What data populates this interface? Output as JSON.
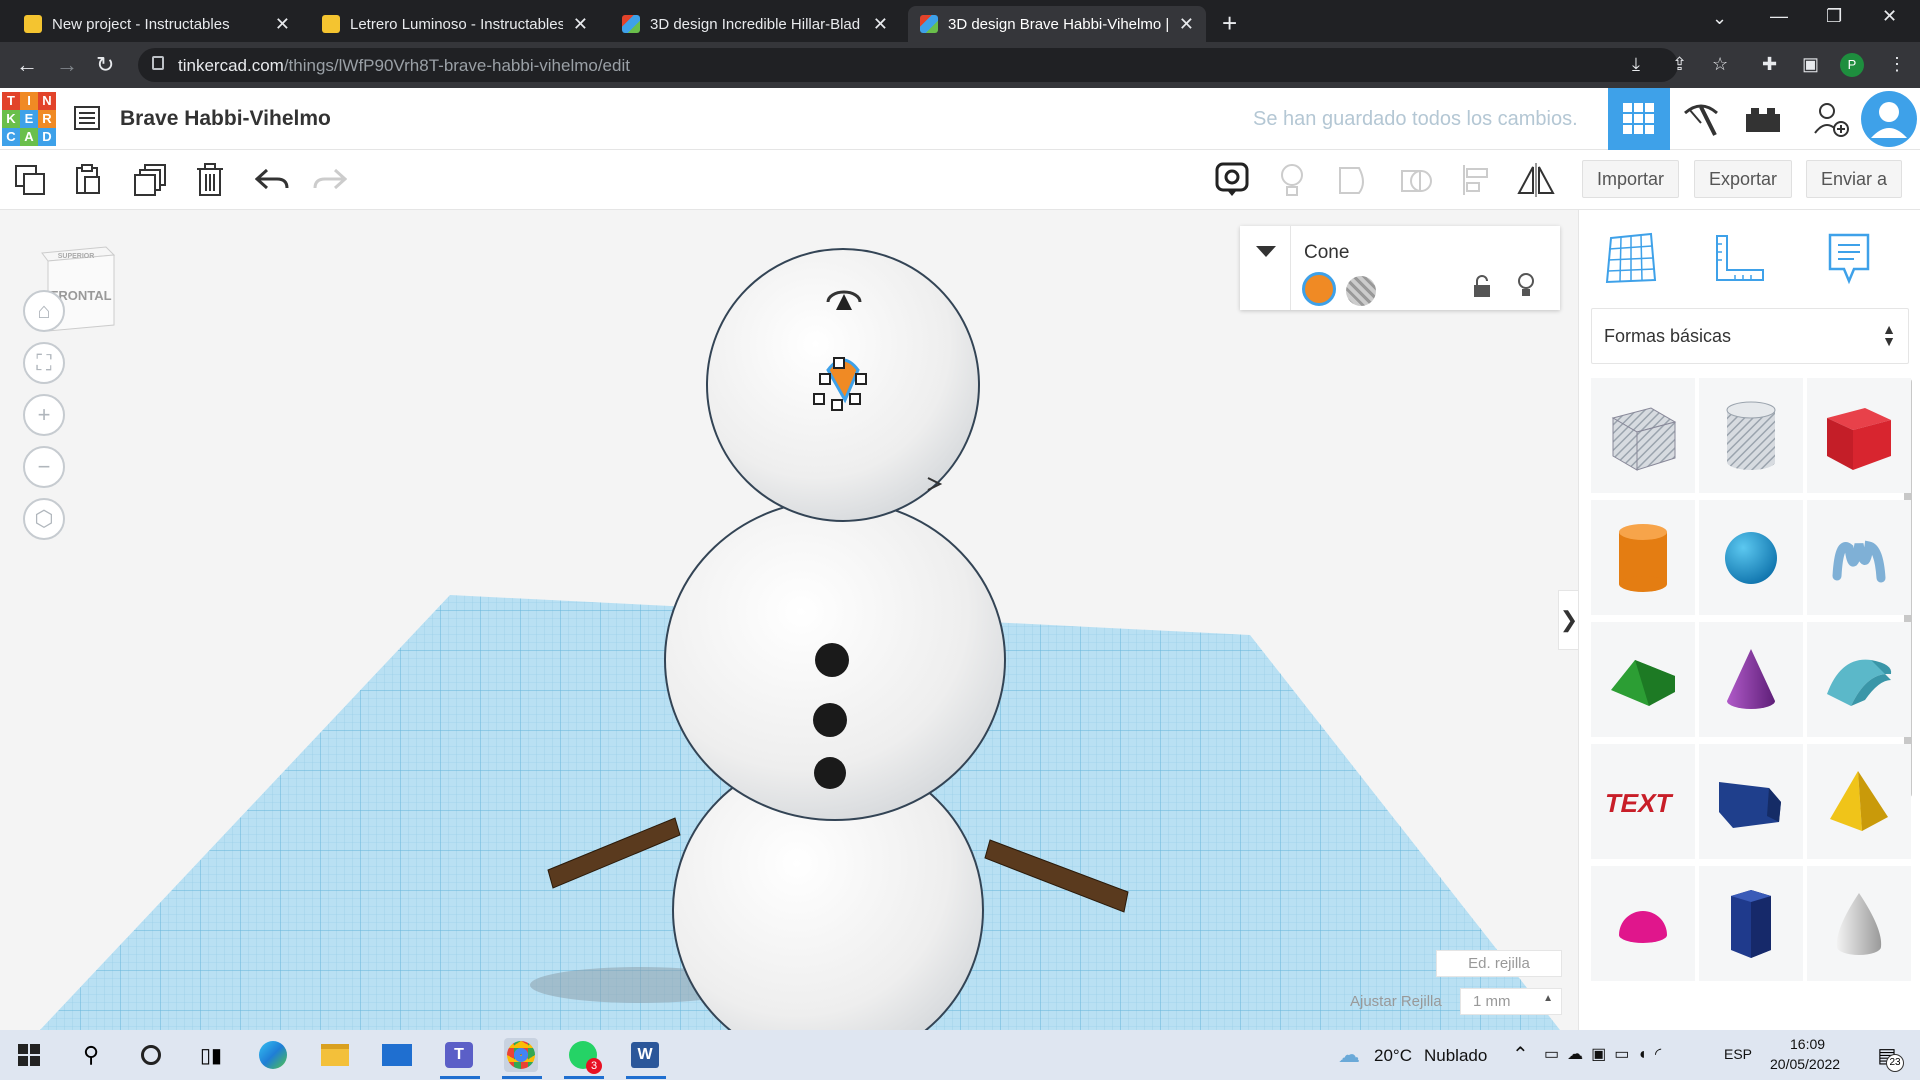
{
  "browser": {
    "tabs": [
      {
        "title": "New project - Instructables",
        "active": false,
        "favicon": "instructables-icon"
      },
      {
        "title": "Letrero Luminoso - Instructables",
        "active": false,
        "favicon": "instructables-icon"
      },
      {
        "title": "3D design Incredible Hillar-Blad |",
        "active": false,
        "favicon": "tinkercad-icon"
      },
      {
        "title": "3D design Brave Habbi-Vihelmo |",
        "active": true,
        "favicon": "tinkercad-icon"
      }
    ],
    "url_host": "tinkercad.com",
    "url_path": "/things/lWfP90Vrh8T-brave-habbi-vihelmo/edit",
    "profile_initial": "P"
  },
  "tinkercad": {
    "logo_letters": [
      "T",
      "I",
      "N",
      "K",
      "E",
      "R",
      "C",
      "A",
      "D"
    ],
    "design_title": "Brave Habbi-Vihelmo",
    "save_status": "Se han guardado todos los cambios.",
    "toolbar": {
      "import_label": "Importar",
      "export_label": "Exportar",
      "send_label": "Enviar a"
    },
    "viewcube": {
      "top_label": "SUPERIOR",
      "front_label": "FRONTAL"
    },
    "inspector": {
      "shape_name": "Cone",
      "color": "#f08a24"
    },
    "grid": {
      "edit_grid_label": "Ed. rejilla",
      "snap_grid_label": "Ajustar Rejilla",
      "snap_grid_value": "1 mm"
    },
    "panel": {
      "category": "Formas básicas",
      "shapes": [
        "box-hole-icon",
        "cylinder-hole-icon",
        "box-icon",
        "cylinder-icon",
        "sphere-icon",
        "scribble-icon",
        "roof-icon",
        "cone-icon",
        "round-roof-icon",
        "text-icon",
        "wedge-icon",
        "pyramid-icon",
        "half-sphere-icon",
        "polygon-icon",
        "paraboloid-icon"
      ],
      "text_shape_label": "TEXT"
    }
  },
  "taskbar": {
    "weather_temp": "20°C",
    "weather_desc": "Nublado",
    "language": "ESP",
    "time": "16:09",
    "date": "20/05/2022",
    "notifications": "23",
    "whatsapp_badge": "3"
  },
  "colors": {
    "accent_blue": "#3ea1e9",
    "grid_blue": "#a9d7ef",
    "cone_orange": "#f08a24",
    "stick_brown": "#5a3a1e"
  }
}
